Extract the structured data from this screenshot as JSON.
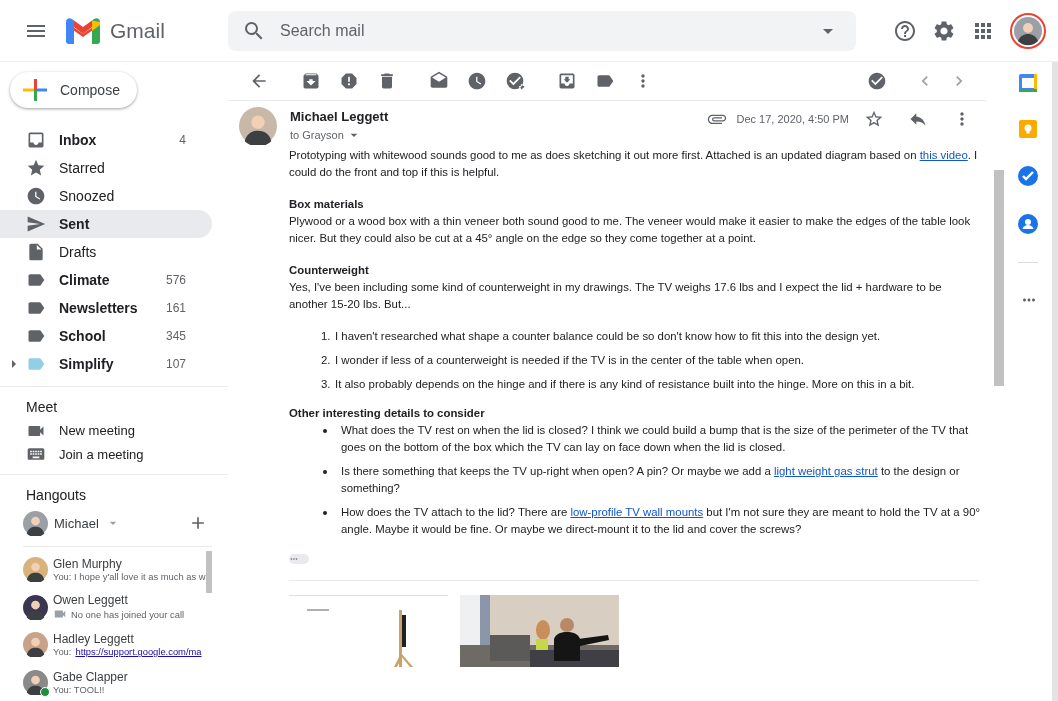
{
  "header": {
    "app_name": "Gmail",
    "search": {
      "placeholder": "Search mail"
    }
  },
  "sidebar": {
    "compose": "Compose",
    "folders": [
      {
        "kind": "inbox",
        "label": "Inbox",
        "count": "4",
        "unread": true,
        "selected": false
      },
      {
        "kind": "starred",
        "label": "Starred",
        "unread": false,
        "selected": false
      },
      {
        "kind": "snoozed",
        "label": "Snoozed",
        "unread": false,
        "selected": false
      },
      {
        "kind": "sent",
        "label": "Sent",
        "unread": false,
        "selected": true
      },
      {
        "kind": "drafts",
        "label": "Drafts",
        "unread": false,
        "selected": false
      },
      {
        "kind": "label",
        "label": "Climate",
        "count": "576",
        "unread": true,
        "selected": false,
        "color": "#5f6368"
      },
      {
        "kind": "label",
        "label": "Newsletters",
        "count": "161",
        "unread": true,
        "selected": false,
        "color": "#5f6368"
      },
      {
        "kind": "label",
        "label": "School",
        "count": "345",
        "unread": true,
        "selected": false,
        "color": "#5f6368"
      },
      {
        "kind": "label",
        "label": "Simplify",
        "count": "107",
        "unread": true,
        "selected": false,
        "color": "#8fd0e6",
        "expanded": false
      }
    ],
    "meet": {
      "title": "Meet",
      "items": [
        {
          "kind": "video",
          "label": "New meeting"
        },
        {
          "kind": "keyboard",
          "label": "Join a meeting"
        }
      ]
    },
    "hangouts": {
      "title": "Hangouts",
      "user": "Michael",
      "contacts": [
        {
          "name": "Glen Murphy",
          "message": "You: I hope y'all love it as much as w",
          "online": false
        },
        {
          "name": "Owen Leggett",
          "message": "No one has joined your call",
          "call": true,
          "online": false
        },
        {
          "name": "Hadley Leggett",
          "message": "You: ",
          "link": "https://support.google.com/ma",
          "online": false
        },
        {
          "name": "Gabe Clapper",
          "message": "You: TOOL!!",
          "online": true
        }
      ]
    }
  },
  "email": {
    "sender": "Michael Leggett",
    "to": "to Grayson",
    "date": "Dec 17, 2020, 4:50 PM",
    "starred": false,
    "body": [
      {
        "kind": "paragraph",
        "parts": [
          {
            "text": "Prototyping with whitewood sounds good to me as does sketching it out more first. Attached is an updated diagram based on "
          },
          {
            "text": "this video",
            "link": true
          },
          {
            "text": ". I could do the front and top if this is helpful."
          }
        ]
      },
      {
        "kind": "heading",
        "text": "Box materials"
      },
      {
        "kind": "paragraph",
        "parts": [
          {
            "text": "Plywood or a wood box with a thin veneer both sound good to me. The veneer would make it easier to make the edges of the table look nicer. But they could also be cut at a 45° angle on the edge so they come together at a point."
          }
        ]
      },
      {
        "kind": "heading",
        "text": "Counterweight"
      },
      {
        "kind": "paragraph",
        "parts": [
          {
            "text": "Yes, I've been including some kind of counterweight in my drawings. The TV weighs 17.6 lbs and I expect the lid + hardware to be another 15-20 lbs. But..."
          }
        ]
      },
      {
        "kind": "ordered",
        "items": [
          {
            "number": "1.",
            "parts": [
              {
                "text": "I haven't researched what shape a counter balance could be so don't know how to fit this into the design yet."
              }
            ]
          },
          {
            "number": "2.",
            "parts": [
              {
                "text": "I wonder if less of a counterweight is needed if the TV is in the center of the table when open."
              }
            ]
          },
          {
            "number": "3.",
            "parts": [
              {
                "text": "It also probably depends on the hinge and if there is any kind of resistance built into the hinge. More on this in a bit."
              }
            ]
          }
        ]
      },
      {
        "kind": "heading",
        "text": "Other interesting details to consider"
      },
      {
        "kind": "bulleted",
        "items": [
          {
            "parts": [
              {
                "text": "What does the TV rest on when the lid is closed? I think we could build a bump that is the size of the perimeter of the TV that goes on the bottom of the box which the TV can lay on face down when the lid is closed."
              }
            ]
          },
          {
            "parts": [
              {
                "text": "Is there something that keeps the TV up-right when open? A pin? Or maybe we add a "
              },
              {
                "text": "light weight gas strut",
                "link": true
              },
              {
                "text": " to the design or something?"
              }
            ]
          },
          {
            "parts": [
              {
                "text": "How does the TV attach to the lid? There are "
              },
              {
                "text": "low-profile TV wall mounts",
                "link": true
              },
              {
                "text": " but I'm not sure they are meant to hold the TV at a 90° angle. Maybe it would be fine. Or maybe we direct-mount it to the lid and cover the screws?"
              }
            ]
          }
        ]
      }
    ]
  }
}
